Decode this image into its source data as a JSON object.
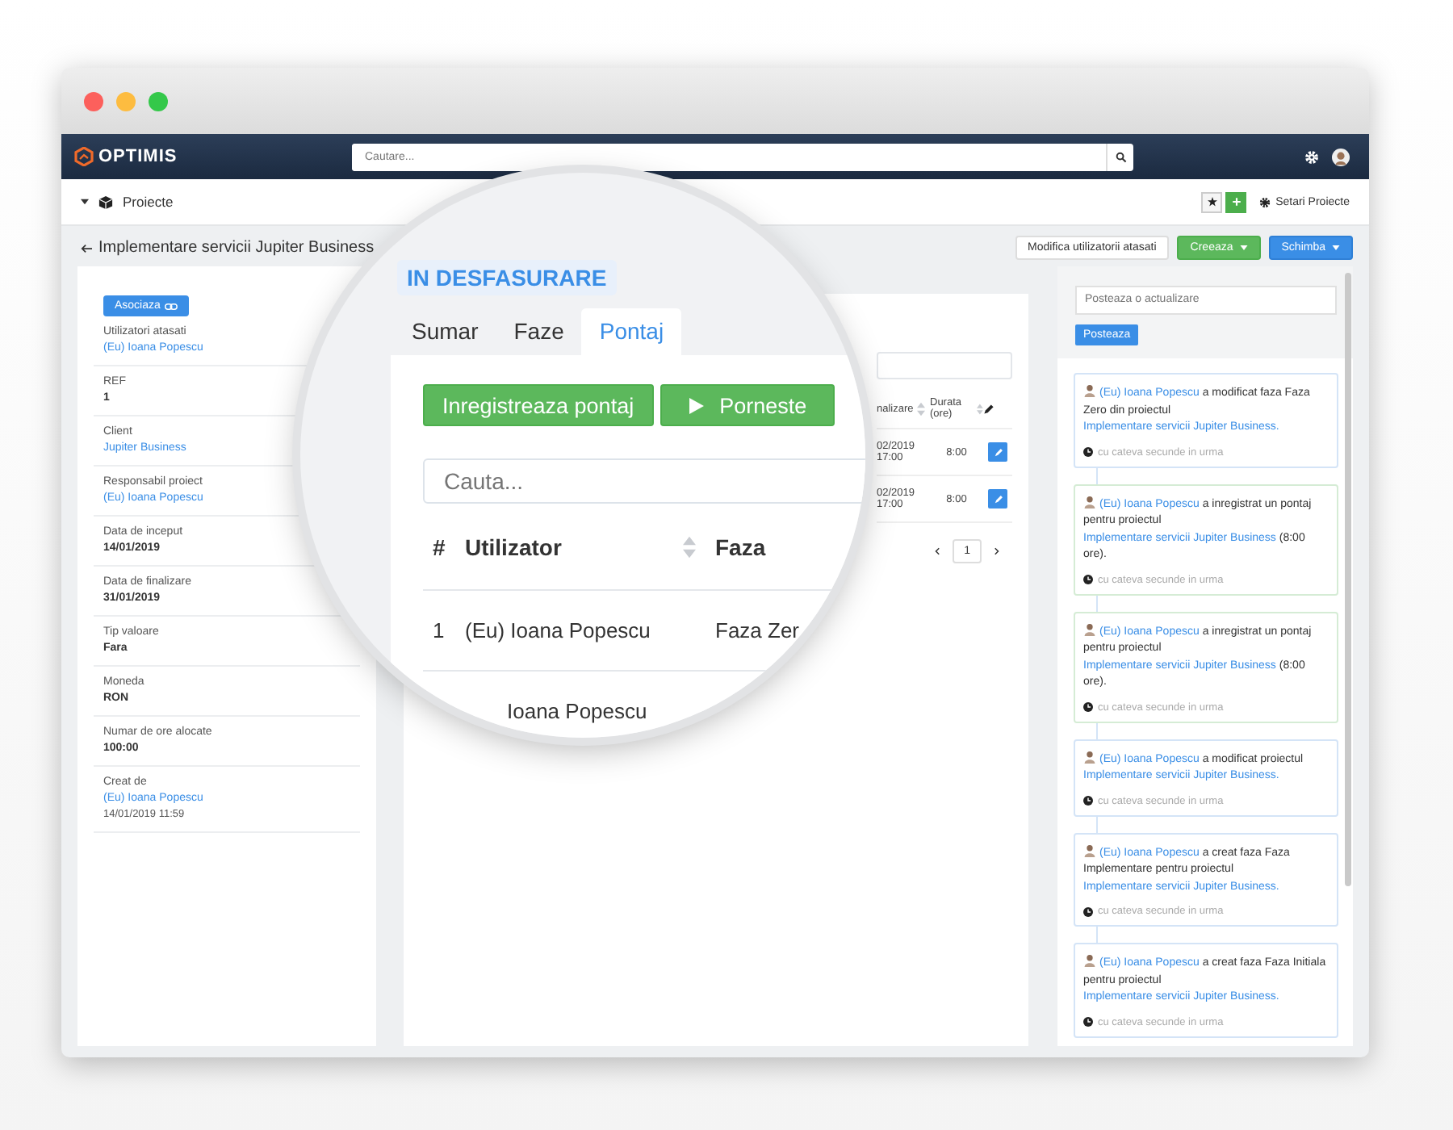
{
  "navbar": {
    "logo": "OPTIMIS",
    "search": {
      "placeholder": "Cautare..."
    }
  },
  "subbar": {
    "section": "Proiecte",
    "settings": "Setari Proiecte"
  },
  "header": {
    "title": "Implementare servicii Jupiter Business",
    "buttons": [
      {
        "label": "Modifica utilizatorii atasati",
        "kind": "default",
        "caret": false
      },
      {
        "label": "Creeaza",
        "kind": "success",
        "caret": true
      },
      {
        "label": "Schimba",
        "kind": "primary",
        "caret": true
      }
    ]
  },
  "details": {
    "button": "Asociaza",
    "fields": [
      {
        "label": "Utilizatori atasati",
        "value": "(Eu) Ioana Popescu",
        "kind": "link"
      },
      {
        "label": "REF",
        "value": "1",
        "kind": "text"
      },
      {
        "label": "Client",
        "value": "Jupiter Business",
        "kind": "link"
      },
      {
        "label": "Responsabil proiect",
        "value": "(Eu) Ioana Popescu",
        "kind": "link"
      },
      {
        "label": "Data de inceput",
        "value": "14/01/2019",
        "kind": "text"
      },
      {
        "label": "Data de finalizare",
        "value": "31/01/2019",
        "kind": "text"
      },
      {
        "label": "Tip valoare",
        "value": "Fara",
        "kind": "text"
      },
      {
        "label": "Moneda",
        "value": "RON",
        "kind": "text"
      },
      {
        "label": "Numar de ore alocate",
        "value": "100:00",
        "kind": "text"
      },
      {
        "label": "Creat de",
        "value": "(Eu) Ioana Popescu",
        "kind": "link",
        "detail": "14/01/2019 11:59"
      }
    ]
  },
  "timesheet": {
    "columns": [
      {
        "label": "nalizare",
        "sortable": true
      },
      {
        "label": "Durata (ore)",
        "sortable": true
      }
    ],
    "rows": [
      {
        "end_date": "02/2019",
        "end_time": "17:00",
        "duration": "8:00"
      },
      {
        "end_date": "02/2019",
        "end_time": "17:00",
        "duration": "8:00"
      }
    ],
    "page": "1"
  },
  "magnifier": {
    "status": "IN DESFASURARE",
    "tabs": [
      {
        "label": "Sumar",
        "selected": false
      },
      {
        "label": "Faze",
        "selected": false
      },
      {
        "label": "Pontaj",
        "selected": true
      }
    ],
    "buttons": [
      {
        "label": "Inregistreaza pontaj",
        "kind": "record"
      },
      {
        "label": "Porneste",
        "kind": "start"
      }
    ],
    "search": {
      "placeholder": "Cauta..."
    },
    "columns": [
      {
        "label": "#",
        "sortable": false
      },
      {
        "label": "Utilizator",
        "sortable": true
      },
      {
        "label": "Faza",
        "sortable": false
      }
    ],
    "rows": [
      {
        "index": "1",
        "user": "(Eu) Ioana Popescu",
        "phase": "Faza Zer"
      },
      {
        "user": "Ioana Popescu"
      }
    ]
  },
  "feed": {
    "placeholder": "Posteaza o actualizare",
    "button": "Posteaza",
    "items": [
      {
        "kind": "change",
        "parts": [
          {
            "text": "(Eu) Ioana Popescu",
            "link": true
          },
          {
            "text": " a modificat faza Faza Zero din proiectul ",
            "link": false
          },
          {
            "text": "Implementare servicii Jupiter Business.",
            "link": true
          }
        ],
        "time": "cu cateva secunde in urma"
      },
      {
        "kind": "timesheet",
        "parts": [
          {
            "text": "(Eu) Ioana Popescu",
            "link": true
          },
          {
            "text": " a inregistrat un pontaj pentru proiectul ",
            "link": false
          },
          {
            "text": "Implementare servicii Jupiter Business",
            "link": true
          },
          {
            "text": " (8:00 ore).",
            "link": false
          }
        ],
        "time": "cu cateva secunde in urma"
      },
      {
        "kind": "timesheet",
        "parts": [
          {
            "text": "(Eu) Ioana Popescu",
            "link": true
          },
          {
            "text": " a inregistrat un pontaj pentru proiectul ",
            "link": false
          },
          {
            "text": "Implementare servicii Jupiter Business",
            "link": true
          },
          {
            "text": " (8:00 ore).",
            "link": false
          }
        ],
        "time": "cu cateva secunde in urma"
      },
      {
        "kind": "change",
        "parts": [
          {
            "text": "(Eu) Ioana Popescu",
            "link": true
          },
          {
            "text": " a modificat proiectul ",
            "link": false
          },
          {
            "text": "Implementare servicii Jupiter Business.",
            "link": true
          }
        ],
        "time": "cu cateva secunde in urma"
      },
      {
        "kind": "change",
        "parts": [
          {
            "text": "(Eu) Ioana Popescu",
            "link": true
          },
          {
            "text": " a creat faza Faza Implementare pentru proiectul ",
            "link": false
          },
          {
            "text": "Implementare servicii Jupiter Business.",
            "link": true
          }
        ],
        "time": "cu cateva secunde in urma"
      },
      {
        "kind": "change",
        "parts": [
          {
            "text": "(Eu) Ioana Popescu",
            "link": true
          },
          {
            "text": " a creat faza Faza Initiala pentru proiectul ",
            "link": false
          },
          {
            "text": "Implementare servicii Jupiter Business.",
            "link": true
          }
        ],
        "time": "cu cateva secunde in urma"
      }
    ]
  }
}
